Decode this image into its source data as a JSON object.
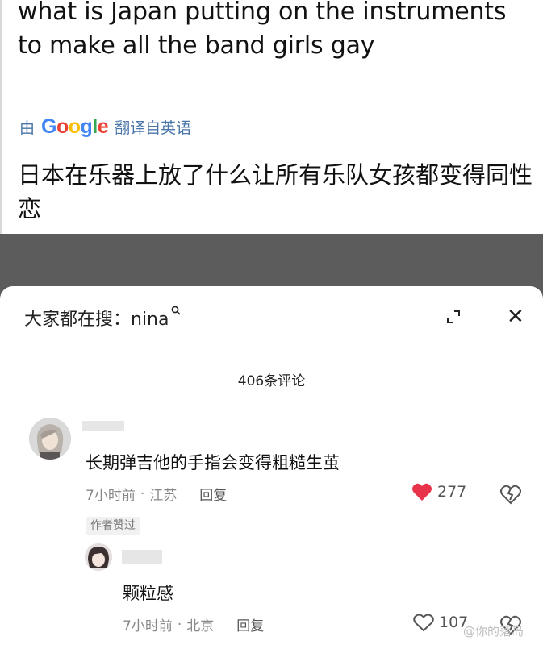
{
  "tweet": {
    "text": "what is Japan putting on the instruments to make all the band girls gay",
    "translate_prefix": "由",
    "google_letters": [
      {
        "ch": "G",
        "color": "#4285F4"
      },
      {
        "ch": "o",
        "color": "#EA4335"
      },
      {
        "ch": "o",
        "color": "#FBBC05"
      },
      {
        "ch": "g",
        "color": "#4285F4"
      },
      {
        "ch": "l",
        "color": "#34A853"
      },
      {
        "ch": "e",
        "color": "#EA4335"
      }
    ],
    "translate_suffix": "翻译自英语",
    "translated_text": "日本在乐器上放了什么让所有乐队女孩都变得同性恋"
  },
  "comments_panel": {
    "search_label": "大家都在搜：nina",
    "count_label": "406条评论",
    "comments": [
      {
        "text": "长期弹吉他的手指会变得粗糙生茧",
        "time": "7小时前",
        "separator": "·",
        "location": "江苏",
        "reply_label": "回复",
        "likes": "277",
        "liked": true,
        "badge": "作者赞过"
      },
      {
        "text": "颗粒感",
        "time": "7小时前",
        "separator": "·",
        "location": "北京",
        "reply_label": "回复",
        "likes": "107",
        "liked": false
      }
    ]
  },
  "watermark": "@你的落岛",
  "colors": {
    "translate_blue": "#4a76a8",
    "like_red": "#e8334a",
    "band_gray": "#5c5c5c"
  }
}
